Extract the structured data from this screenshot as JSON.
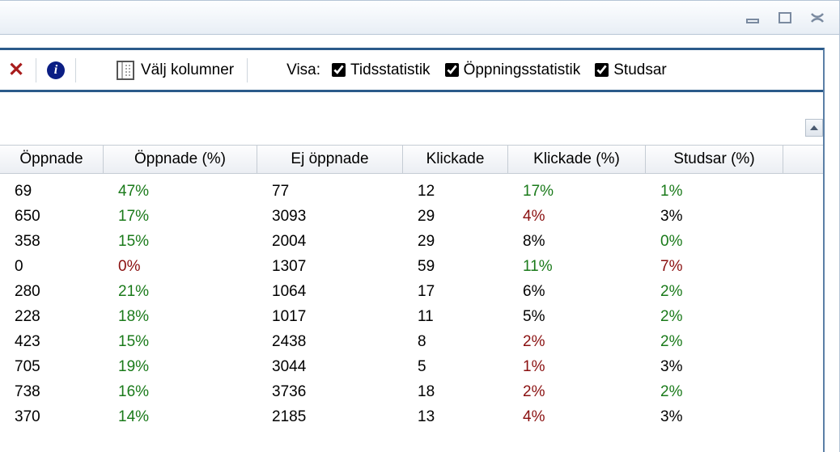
{
  "toolbar": {
    "choose_columns_label": "Välj kolumner",
    "visa_label": "Visa:",
    "checks": {
      "tidsstatistik": {
        "label": "Tidsstatistik",
        "checked": true
      },
      "oppningsstatistik": {
        "label": "Öppningsstatistik",
        "checked": true
      },
      "studsar": {
        "label": "Studsar",
        "checked": true
      }
    }
  },
  "columns": [
    {
      "label": "Öppnade"
    },
    {
      "label": "Öppnade (%)"
    },
    {
      "label": "Ej öppnade"
    },
    {
      "label": "Klickade"
    },
    {
      "label": "Klickade (%)"
    },
    {
      "label": "Studsar (%)"
    }
  ],
  "rows": [
    {
      "oppnade": "69",
      "oppnade_pct": {
        "v": "47%",
        "c": "green"
      },
      "ej": "77",
      "klick": "12",
      "klick_pct": {
        "v": "17%",
        "c": "green"
      },
      "studs": {
        "v": "1%",
        "c": "green"
      }
    },
    {
      "oppnade": "650",
      "oppnade_pct": {
        "v": "17%",
        "c": "green"
      },
      "ej": "3093",
      "klick": "29",
      "klick_pct": {
        "v": "4%",
        "c": "red"
      },
      "studs": {
        "v": "3%",
        "c": ""
      }
    },
    {
      "oppnade": "358",
      "oppnade_pct": {
        "v": "15%",
        "c": "green"
      },
      "ej": "2004",
      "klick": "29",
      "klick_pct": {
        "v": "8%",
        "c": ""
      },
      "studs": {
        "v": "0%",
        "c": "green"
      }
    },
    {
      "oppnade": "0",
      "oppnade_pct": {
        "v": "0%",
        "c": "red"
      },
      "ej": "1307",
      "klick": "59",
      "klick_pct": {
        "v": "11%",
        "c": "green"
      },
      "studs": {
        "v": "7%",
        "c": "red"
      }
    },
    {
      "oppnade": "280",
      "oppnade_pct": {
        "v": "21%",
        "c": "green"
      },
      "ej": "1064",
      "klick": "17",
      "klick_pct": {
        "v": "6%",
        "c": ""
      },
      "studs": {
        "v": "2%",
        "c": "green"
      }
    },
    {
      "oppnade": "228",
      "oppnade_pct": {
        "v": "18%",
        "c": "green"
      },
      "ej": "1017",
      "klick": "11",
      "klick_pct": {
        "v": "5%",
        "c": ""
      },
      "studs": {
        "v": "2%",
        "c": "green"
      }
    },
    {
      "oppnade": "423",
      "oppnade_pct": {
        "v": "15%",
        "c": "green"
      },
      "ej": "2438",
      "klick": "8",
      "klick_pct": {
        "v": "2%",
        "c": "red"
      },
      "studs": {
        "v": "2%",
        "c": "green"
      }
    },
    {
      "oppnade": "705",
      "oppnade_pct": {
        "v": "19%",
        "c": "green"
      },
      "ej": "3044",
      "klick": "5",
      "klick_pct": {
        "v": "1%",
        "c": "red"
      },
      "studs": {
        "v": "3%",
        "c": ""
      }
    },
    {
      "oppnade": "738",
      "oppnade_pct": {
        "v": "16%",
        "c": "green"
      },
      "ej": "3736",
      "klick": "18",
      "klick_pct": {
        "v": "2%",
        "c": "red"
      },
      "studs": {
        "v": "2%",
        "c": "green"
      }
    },
    {
      "oppnade": "370",
      "oppnade_pct": {
        "v": "14%",
        "c": "green"
      },
      "ej": "2185",
      "klick": "13",
      "klick_pct": {
        "v": "4%",
        "c": "red"
      },
      "studs": {
        "v": "3%",
        "c": ""
      }
    }
  ]
}
